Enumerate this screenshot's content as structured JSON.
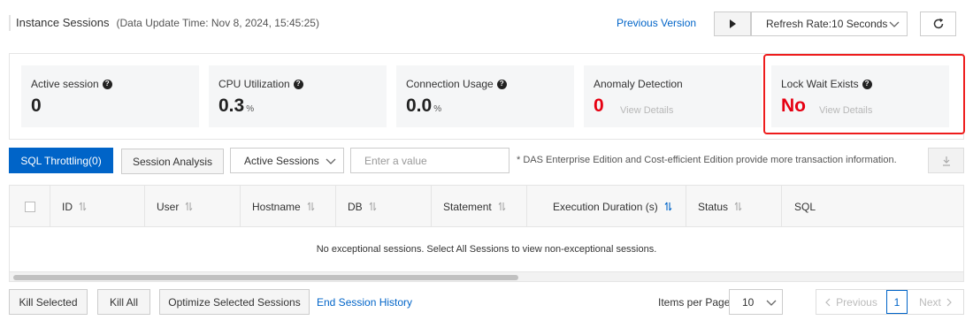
{
  "header": {
    "title": "Instance Sessions",
    "update_time": "(Data Update Time: Nov 8, 2024, 15:45:25)",
    "previous_version": "Previous Version",
    "refresh_rate": "Refresh Rate:10 Seconds"
  },
  "metrics": [
    {
      "label": "Active session",
      "value": "0",
      "unit": ""
    },
    {
      "label": "CPU Utilization",
      "value": "0.3",
      "unit": "%"
    },
    {
      "label": "Connection Usage",
      "value": "0.0",
      "unit": "%"
    },
    {
      "label": "Anomaly Detection",
      "value": "0",
      "link": "View Details"
    },
    {
      "label": "Lock Wait Exists",
      "value": "No",
      "link": "View Details"
    }
  ],
  "toolbar": {
    "sql_throttling": "SQL Throttling(0)",
    "session_analysis": "Session Analysis",
    "sessions_filter": "Active Sessions",
    "search_placeholder": "Enter a value",
    "note": "* DAS Enterprise Edition and Cost-efficient Edition provide more transaction information."
  },
  "table": {
    "columns": [
      "ID",
      "User",
      "Hostname",
      "DB",
      "Statement",
      "Execution Duration (s)",
      "Status",
      "SQL"
    ],
    "empty_message": "No exceptional sessions. Select All Sessions to view non-exceptional sessions."
  },
  "footer": {
    "kill_selected": "Kill Selected",
    "kill_all": "Kill All",
    "optimize": "Optimize Selected Sessions",
    "end_history": "End Session History",
    "items_per_page_label": "Items per Page",
    "items_per_page": "10",
    "previous": "Previous",
    "current_page": "1",
    "next": "Next"
  },
  "colors": {
    "primary": "#0064c8",
    "alert_red": "#e60012",
    "highlight_border": "#ee1c1c"
  }
}
